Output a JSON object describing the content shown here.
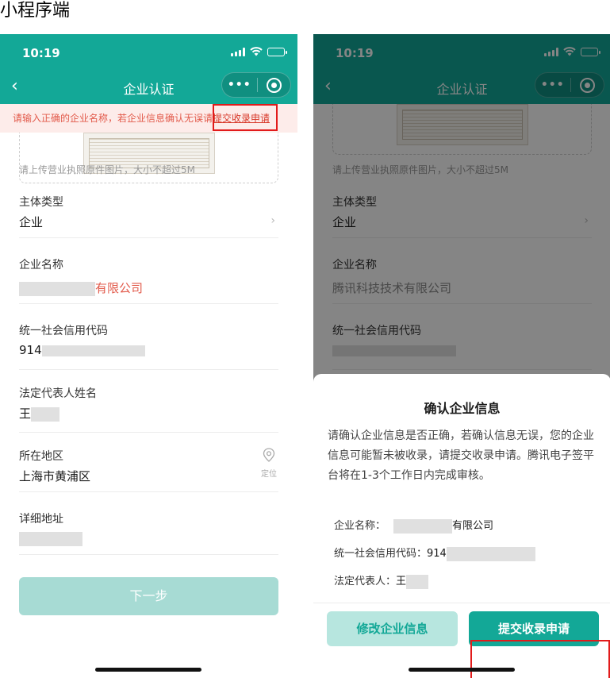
{
  "page_title": "小程序端",
  "status_bar": {
    "time": "10:19"
  },
  "nav": {
    "back_icon": "‹",
    "title": "企业认证",
    "more_icon": "•••"
  },
  "notice": {
    "text": "请输入正确的企业名称，若企业信息确认无误请",
    "link": "提交收录申请"
  },
  "form": {
    "upload_hint": "请上传营业执照原件图片，大小不超过5M",
    "subject_type": {
      "label": "主体类型",
      "value": "企业"
    },
    "company_name": {
      "label": "企业名称",
      "value_suffix": "有限公司",
      "placeholder_value": "腾讯科技技术有限公司"
    },
    "credit_code": {
      "label": "统一社会信用代码",
      "value_prefix": "914"
    },
    "legal_rep": {
      "label": "法定代表人姓名",
      "value_prefix": "王"
    },
    "region": {
      "label": "所在地区",
      "value": "上海市黄浦区",
      "locate_label": "定位"
    },
    "address": {
      "label": "详细地址"
    },
    "next_button": "下一步"
  },
  "dialog": {
    "title": "确认企业信息",
    "description": "请确认企业信息是否正确，若确认信息无误，您的企业信息可能暂未被收录，请提交收录申请。腾讯电子签平台将在1-3个工作日内完成审核。",
    "company_label": "企业名称：",
    "company_value_suffix": "有限公司",
    "credit_label": "统一社会信用代码：",
    "credit_value_prefix": "914",
    "legal_label": "法定代表人：",
    "legal_value_prefix": "王",
    "modify_button": "修改企业信息",
    "submit_button": "提交收录申请"
  },
  "colors": {
    "brand": "#13a897",
    "error": "#e25a4b",
    "highlight_box": "#e21b1b"
  }
}
